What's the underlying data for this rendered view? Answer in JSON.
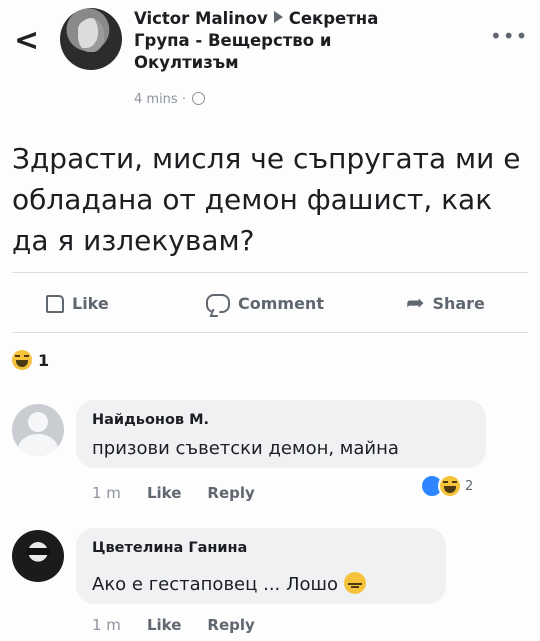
{
  "header": {
    "author": "Victor Malinov",
    "group": "Секретна Група - Вещерство и Окултизъм",
    "time": "4 mins ·",
    "back_icon": "chevron-left-icon",
    "more_icon": "more-icon",
    "privacy_icon": "globe-icon"
  },
  "post": {
    "text": "Здрасти, мисля че съпругата ми е обладана от демон фашист, как да я излекувам?"
  },
  "actions": {
    "like": "Like",
    "comment": "Comment",
    "share": "Share"
  },
  "reactions": {
    "count": "1",
    "icon": "haha-icon"
  },
  "comments": [
    {
      "author": "Найдьонов М.",
      "text": "призови съветски демон, майна",
      "time": "1 m",
      "like": "Like",
      "reply": "Reply",
      "reaction_count": "2"
    },
    {
      "author": "Цветелина Ганина",
      "text": "Ако е гестаповец ... Лошо",
      "time": "1 m",
      "like": "Like",
      "reply": "Reply"
    }
  ],
  "colors": {
    "bubble": "#eff1f3",
    "muted": "#606770",
    "like_blue": "#2d86ff",
    "emoji": "#f5c33b"
  }
}
